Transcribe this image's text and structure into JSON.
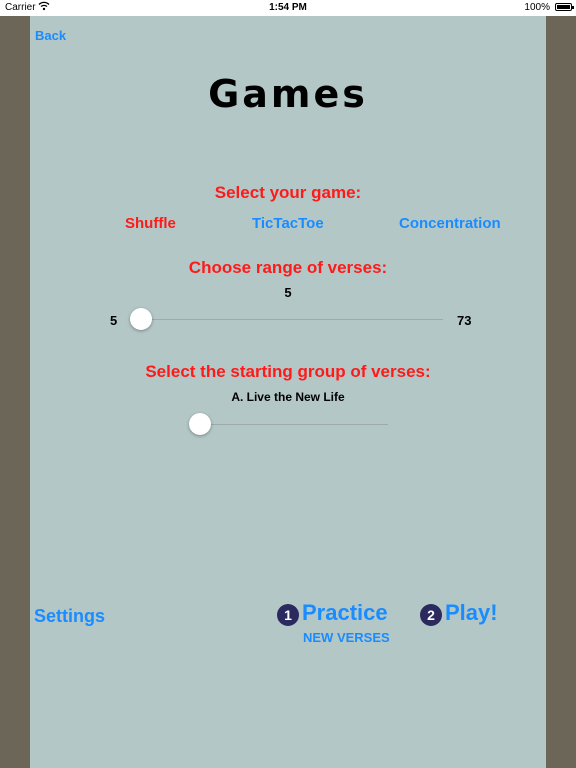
{
  "status_bar": {
    "carrier": "Carrier",
    "wifi_icon": "wifi-icon",
    "time": "1:54 PM",
    "battery": "100%"
  },
  "nav": {
    "back": "Back"
  },
  "title": "Games",
  "game_select": {
    "heading": "Select your game:",
    "options": [
      "Shuffle",
      "TicTacToe",
      "Concentration"
    ],
    "selected": "Shuffle"
  },
  "range": {
    "heading": "Choose range of verses:",
    "value": "5",
    "min": "5",
    "max": "73",
    "level": 0
  },
  "group": {
    "heading": "Select the starting group of verses:",
    "current": "A. Live the New Life",
    "level": 0
  },
  "footer": {
    "settings": "Settings",
    "practice_num": "1",
    "practice": "Practice",
    "practice_sub": "NEW VERSES",
    "play_num": "2",
    "play": "Play!"
  },
  "colors": {
    "panel": "#b4c7c7",
    "accent_blue": "#1a8cff",
    "accent_red": "#ff1a1a",
    "badge": "#2a2a5e"
  }
}
